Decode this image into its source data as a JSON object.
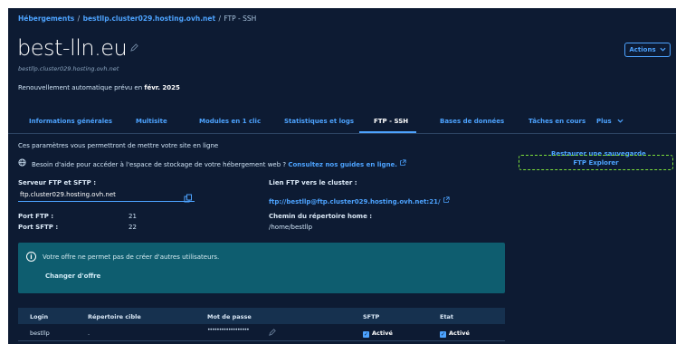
{
  "breadcrumb": {
    "hosting": "Hébergements",
    "separator": "/",
    "cluster": "bestllp.cluster029.hosting.ovh.net",
    "current": "FTP - SSH"
  },
  "header": {
    "title": "best-lln.eu",
    "subtitle": "bestllp.cluster029.hosting.ovh.net",
    "renewal_prefix": "Renouvellement automatique prévu en",
    "renewal_date": "févr. 2025",
    "actions_label": "Actions",
    "actions_icon": "chevron-down-icon"
  },
  "tabs": [
    {
      "label": "Informations générales"
    },
    {
      "label": "Multisite"
    },
    {
      "label": "Modules en 1 clic"
    },
    {
      "label": "Statistiques et logs"
    },
    {
      "label": "FTP - SSH"
    },
    {
      "label": "Bases de données"
    },
    {
      "label": "Tâches en cours"
    },
    {
      "label": "Plus"
    }
  ],
  "active_tab": "FTP - SSH",
  "main": {
    "intro": "Ces paramètres vous permettront de mettre votre site en ligne",
    "help_text": "Besoin d'aide pour accéder à l'espace de stockage de votre hébergement web ?",
    "help_link": "Consultez nos guides en ligne.",
    "ftp_server_label": "Serveur FTP et SFTP :",
    "ftp_server_value": "ftp.cluster029.hosting.ovh.net",
    "ftp_port_label": "Port FTP :",
    "ftp_port_value": "21",
    "sftp_port_label": "Port SFTP :",
    "sftp_port_value": "22",
    "cluster_link_label": "Lien FTP vers le cluster :",
    "cluster_link_value": "ftp://bestllp@ftp.cluster029.hosting.ovh.net:21/",
    "home_label": "Chemin du répertoire home :",
    "home_value": "/home/bestllp"
  },
  "side": {
    "restore": "Restaurer une sauvegarde",
    "ftp_explorer": "FTP Explorer"
  },
  "info_box": {
    "text": "Votre offre ne permet pas de créer d'autres utilisateurs.",
    "change_offer": "Changer d'offre"
  },
  "table": {
    "headers": {
      "login": "Login",
      "target_dir": "Répertoire cible",
      "password": "Mot de passe",
      "sftp": "SFTP",
      "state": "Etat"
    },
    "rows": [
      {
        "login": "bestllp",
        "target_dir": ".",
        "password": "••••••••••••••••••",
        "sftp": "Activé",
        "state": "Activé"
      }
    ]
  },
  "colors": {
    "background": "#0d1b33",
    "accent": "#4da3ff",
    "info_box": "#0e5d6f",
    "explorer_outline": "#7ddf3a"
  }
}
